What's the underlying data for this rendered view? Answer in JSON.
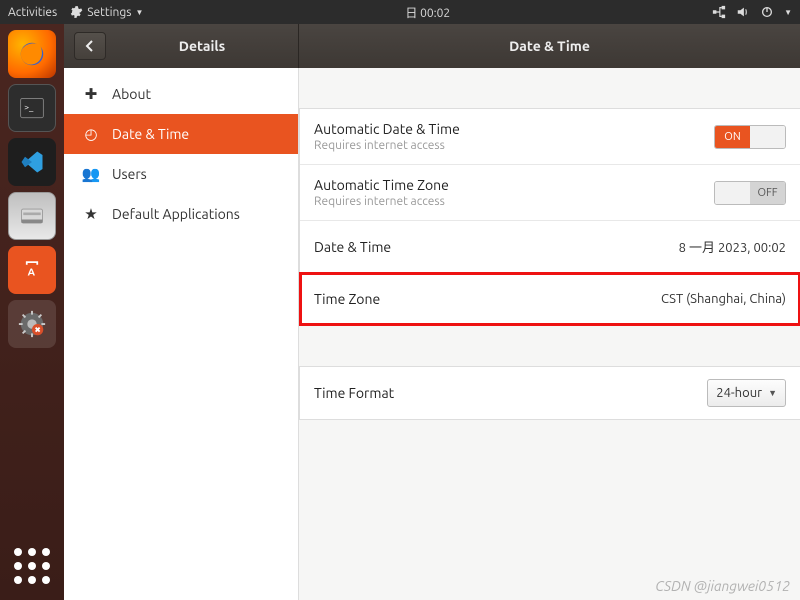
{
  "topbar": {
    "activities": "Activities",
    "app_menu": "Settings",
    "clock": "日 00:02"
  },
  "dock": {
    "items": [
      "firefox",
      "terminal",
      "vscode",
      "files",
      "software",
      "settings"
    ]
  },
  "window": {
    "details_title": "Details",
    "page_title": "Date & Time"
  },
  "sidebar": {
    "items": [
      {
        "icon": "✚",
        "label": "About"
      },
      {
        "icon": "◴",
        "label": "Date & Time"
      },
      {
        "icon": "👥",
        "label": "Users"
      },
      {
        "icon": "★",
        "label": "Default Applications"
      }
    ],
    "active_index": 1
  },
  "settings": {
    "auto_datetime": {
      "label": "Automatic Date & Time",
      "sub": "Requires internet access",
      "state": "ON"
    },
    "auto_tz": {
      "label": "Automatic Time Zone",
      "sub": "Requires internet access",
      "state": "OFF"
    },
    "datetime": {
      "label": "Date & Time",
      "value": "8 一月 2023, 00:02"
    },
    "timezone": {
      "label": "Time Zone",
      "value": "CST (Shanghai, China)"
    },
    "timeformat": {
      "label": "Time Format",
      "value": "24-hour"
    }
  },
  "watermark": "CSDN @jiangwei0512"
}
